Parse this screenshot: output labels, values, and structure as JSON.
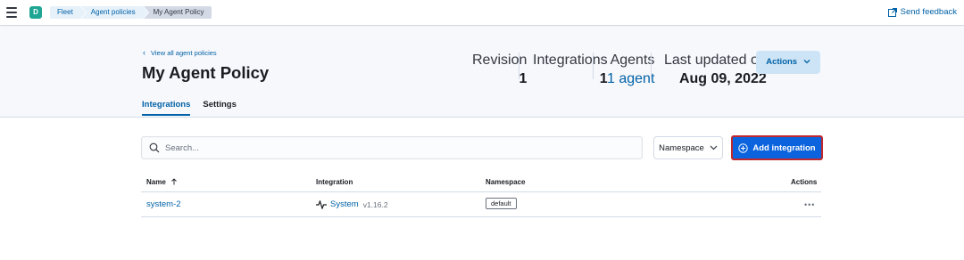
{
  "topbar": {
    "avatar_initial": "D",
    "breadcrumbs": [
      "Fleet",
      "Agent policies",
      "My Agent Policy"
    ],
    "feedback_label": "Send feedback"
  },
  "header": {
    "back_link": "View all agent policies",
    "title": "My Agent Policy",
    "stats": [
      {
        "label": "Revision",
        "value": "1"
      },
      {
        "label": "Integrations",
        "value": "1"
      },
      {
        "label": "Agents",
        "value": "1 agent"
      },
      {
        "label": "Last updated on",
        "value": "Aug 09, 2022"
      }
    ],
    "actions_label": "Actions",
    "tabs": [
      "Integrations",
      "Settings"
    ]
  },
  "toolbar": {
    "search_placeholder": "Search...",
    "namespace_label": "Namespace",
    "add_label": "Add integration"
  },
  "table": {
    "columns": [
      "Name",
      "Integration",
      "Namespace",
      "Actions"
    ],
    "rows": [
      {
        "name": "system-2",
        "integration": "System",
        "version": "v1.16.2",
        "namespace": "default",
        "actions": "•••"
      }
    ]
  },
  "colors": {
    "link": "#0061a6",
    "primary_button": "#0b64dd",
    "highlight_border": "#c0282d",
    "avatar": "#1ea593"
  }
}
